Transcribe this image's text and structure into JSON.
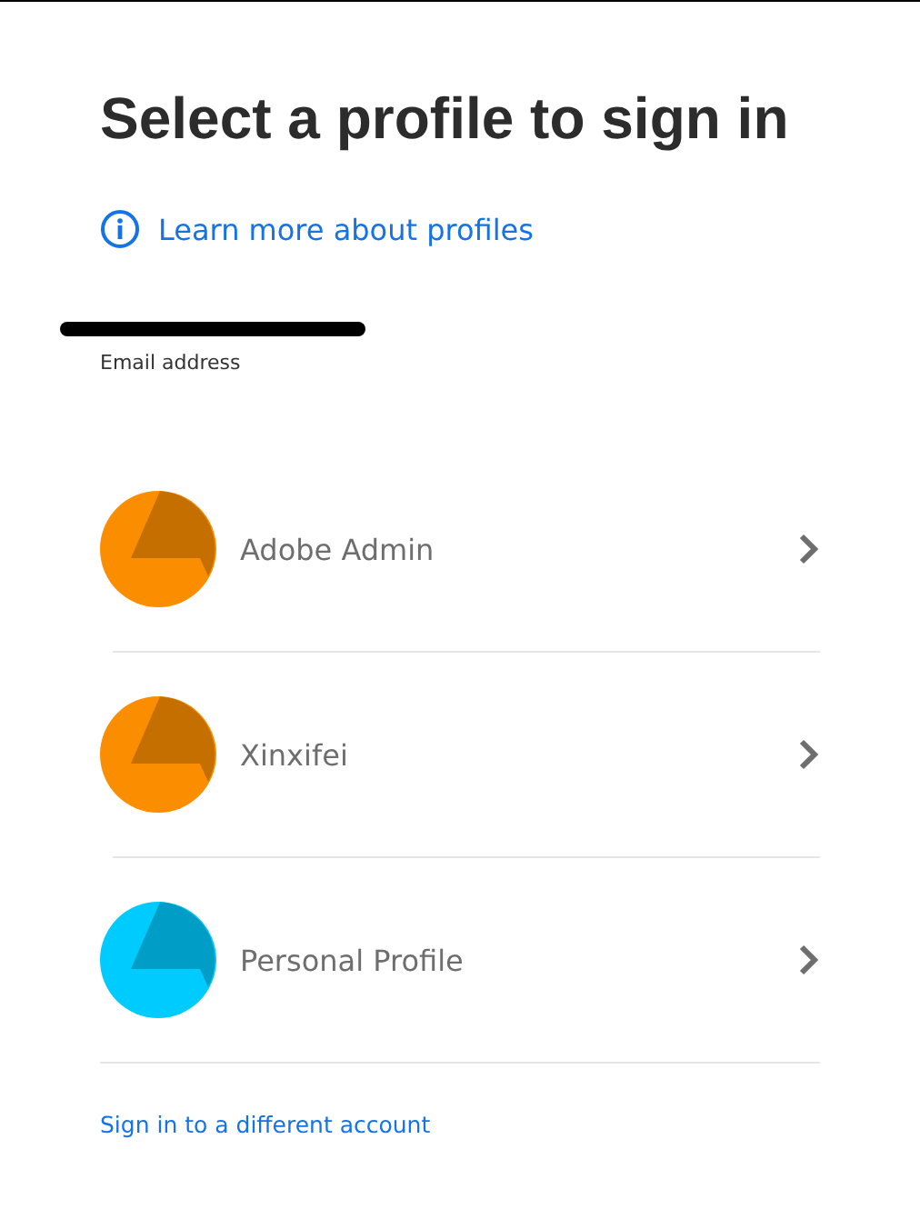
{
  "title": "Select a profile to sign in",
  "learn_more_link": "Learn more about profiles",
  "account": {
    "email_label": "Email address"
  },
  "profiles": [
    {
      "name": "Adobe Admin",
      "color": "#fb8e00"
    },
    {
      "name": "Xinxifei",
      "color": "#fb8e00"
    },
    {
      "name": "Personal Profile",
      "color": "#00cbff"
    }
  ],
  "different_account_link": "Sign in to a different account"
}
